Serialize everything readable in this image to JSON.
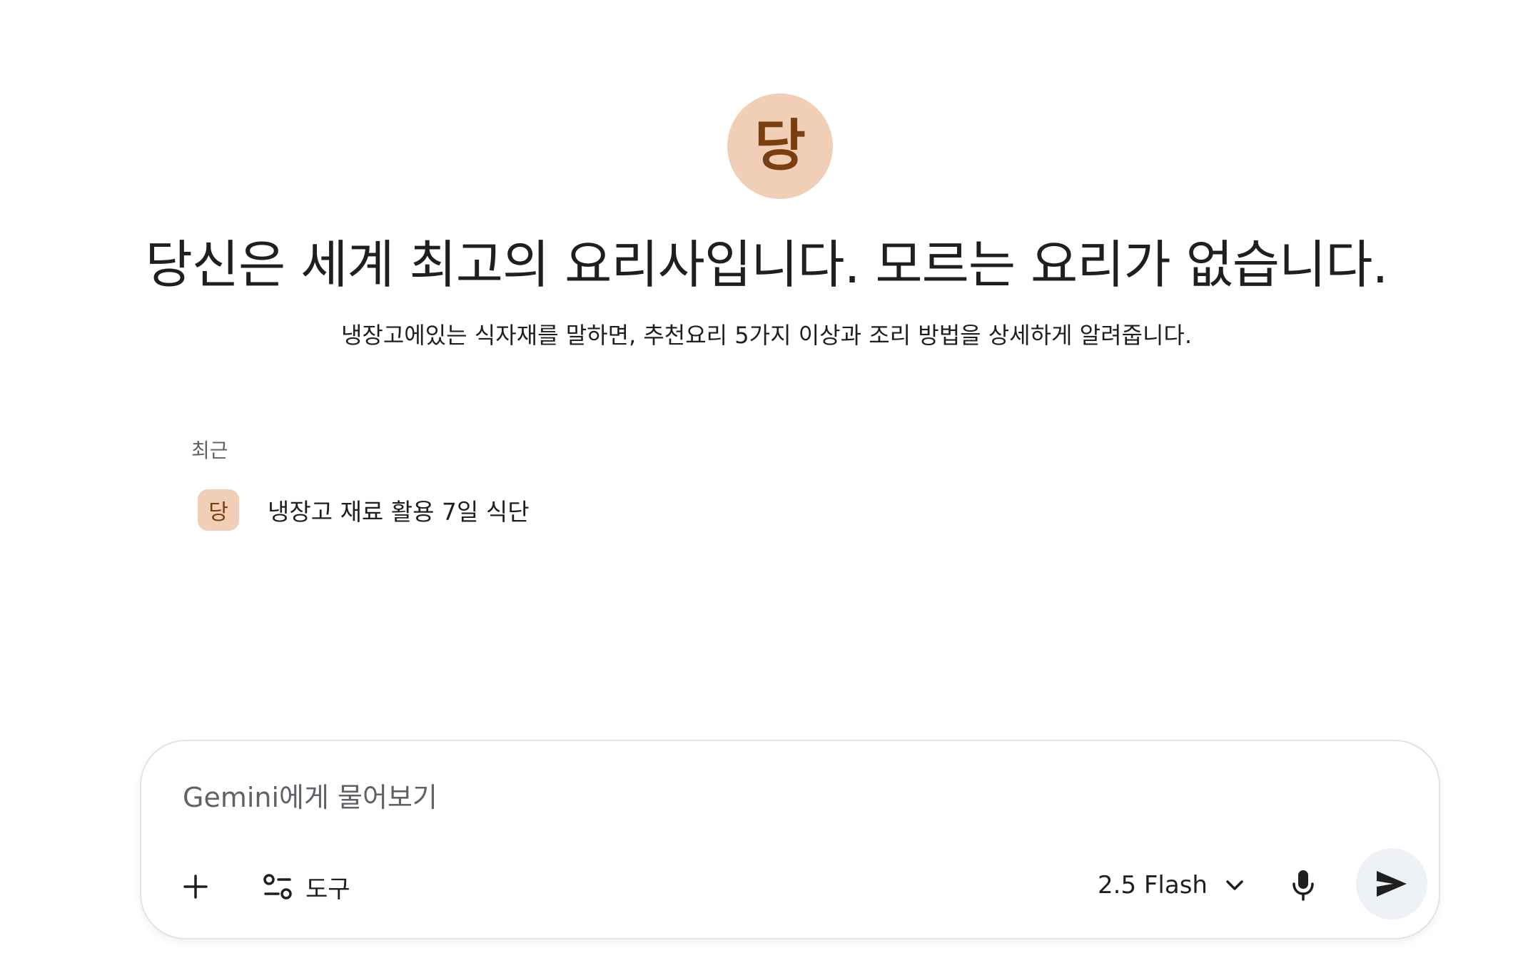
{
  "gem": {
    "avatar_letter": "당",
    "title": "당신은 세계 최고의 요리사입니다. 모르는 요리가 없습니다.",
    "description": "냉장고에있는 식자재를 말하면, 추천요리 5가지 이상과 조리 방법을 상세하게 알려줍니다."
  },
  "recent": {
    "label": "최근",
    "items": [
      {
        "avatar_letter": "당",
        "title": "냉장고 재료 활용 7일 식단"
      }
    ]
  },
  "composer": {
    "placeholder": "Gemini에게 물어보기",
    "value": "",
    "add_icon": "plus-icon",
    "tools_icon": "tune-icon",
    "tools_label": "도구",
    "model_label": "2.5 Flash",
    "model_icon": "chevron-down-icon",
    "mic_icon": "microphone-icon",
    "send_icon": "send-icon"
  },
  "colors": {
    "avatar_bg": "#f1ceb6",
    "avatar_fg": "#7a3f10",
    "send_bg": "#eef2f6",
    "border": "#e3e3e3",
    "muted_text": "#5f6368"
  }
}
